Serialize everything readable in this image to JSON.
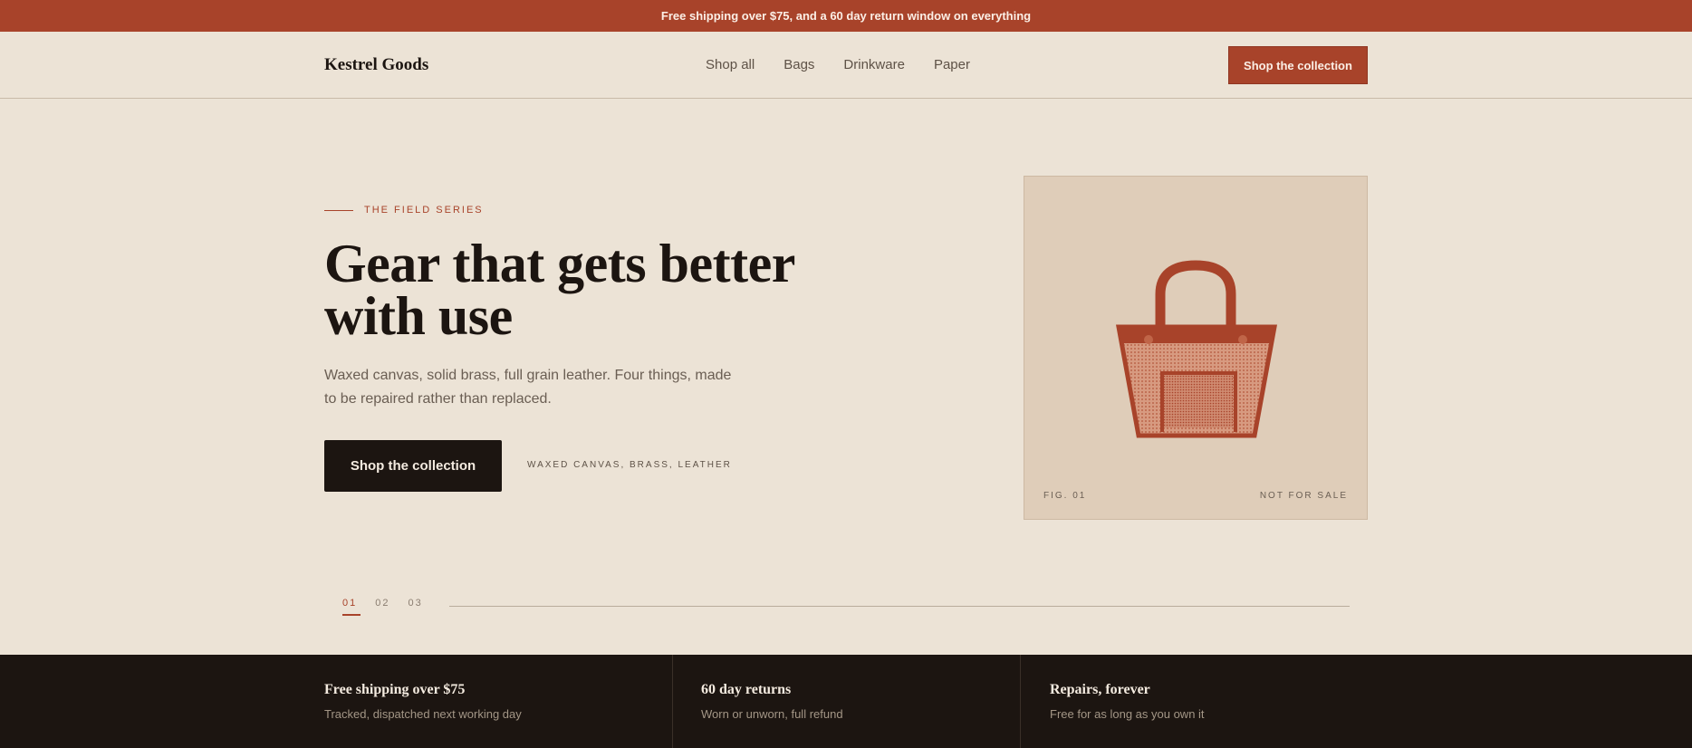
{
  "announcement": "Free shipping over $75, and a 60 day return window on everything",
  "header": {
    "logo": "Kestrel Goods",
    "nav": [
      "Shop all",
      "Bags",
      "Drinkware",
      "Paper"
    ],
    "cta": "Shop the collection"
  },
  "hero": {
    "eyebrow": "THE FIELD SERIES",
    "title": "Gear that gets better with use",
    "subtitle": "Waxed canvas, solid brass, full grain leather. Four things, made to be repaired rather than replaced.",
    "button": "Shop the collection",
    "materials": "WAXED CANVAS, BRASS, LEATHER"
  },
  "figure": {
    "icon": "tote-bag-icon",
    "caption_left": "FIG. 01",
    "caption_right": "NOT FOR SALE"
  },
  "slides": {
    "items": [
      "01",
      "02",
      "03"
    ],
    "active": "01"
  },
  "features": [
    {
      "title": "Free shipping over $75",
      "text": "Tracked, dispatched next working day"
    },
    {
      "title": "60 day returns",
      "text": "Worn or unworn, full refund"
    },
    {
      "title": "Repairs, forever",
      "text": "Free for as long as you own it"
    }
  ],
  "colors": {
    "accent": "#a8432a",
    "background": "#ece3d6",
    "dark": "#1c1511",
    "figure_bg": "#dfcdb9"
  }
}
